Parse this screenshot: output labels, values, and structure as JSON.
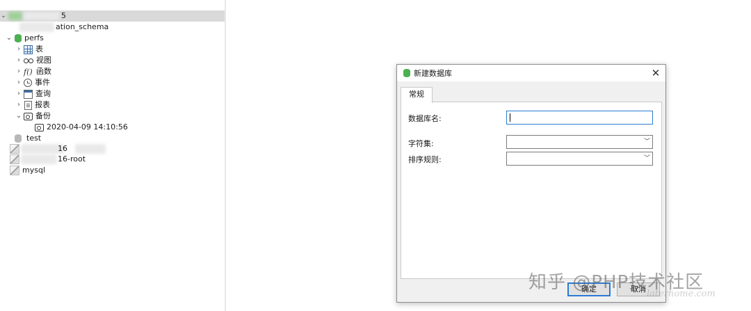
{
  "tree": {
    "connection_partial_suffix": "5",
    "info_schema_label": "ation_schema",
    "perfs_label": "perfs",
    "children": [
      {
        "label": "表",
        "icon": "table-icon"
      },
      {
        "label": "视图",
        "icon": "view-glasses-icon"
      },
      {
        "label": "函数",
        "icon": "function-fx-icon"
      },
      {
        "label": "事件",
        "icon": "event-clock-icon"
      },
      {
        "label": "查询",
        "icon": "query-icon"
      },
      {
        "label": "报表",
        "icon": "report-icon"
      },
      {
        "label": "备份",
        "icon": "backup-icon"
      }
    ],
    "backup_entry": "2020-04-09 14:10:56",
    "test_label": "test",
    "conn2_partial": "16",
    "conn3_partial": "16-root",
    "mysql_label": "mysql"
  },
  "dialog": {
    "title": "新建数据库",
    "close_glyph": "✕",
    "tab_label": "常规",
    "db_name_label": "数据库名:",
    "db_name_value": "",
    "charset_label": "字符集:",
    "charset_value": "",
    "collation_label": "排序规则:",
    "collation_value": "",
    "ok_label": "确定",
    "cancel_label": "取消"
  },
  "watermark": {
    "text": "知乎 @PHP技术社区",
    "small_text": "laterhome.com"
  },
  "colors": {
    "db_active": "#4caf50",
    "db_inactive": "#b8b8b8",
    "focus_border": "#2b7cd3"
  }
}
